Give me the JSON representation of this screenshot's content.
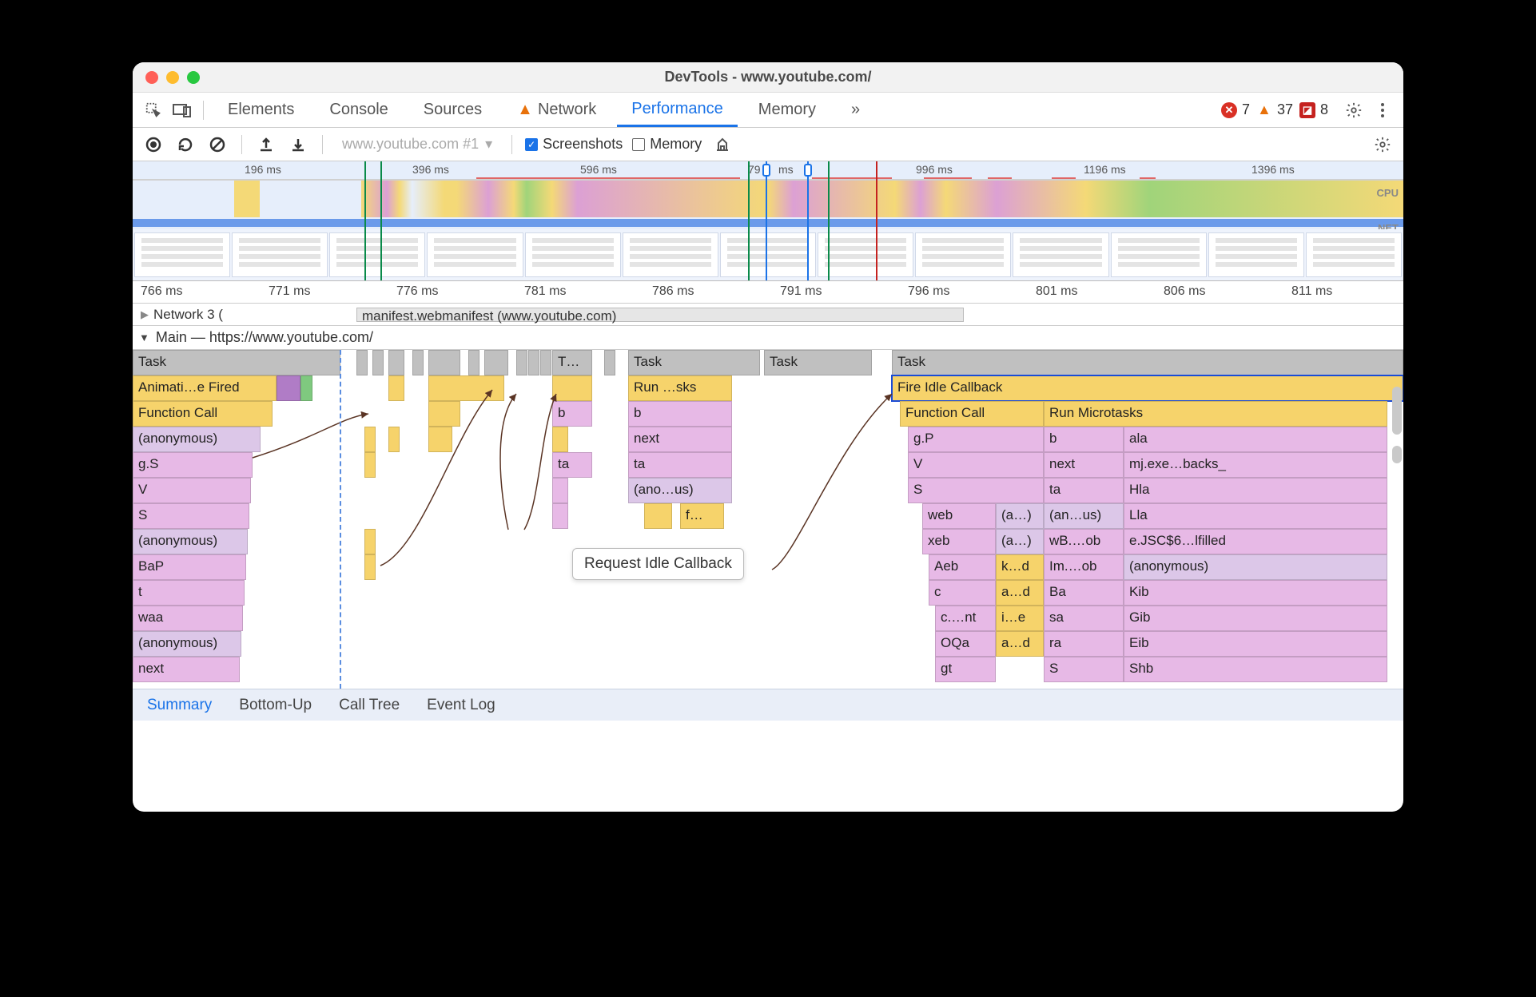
{
  "window": {
    "title": "DevTools - www.youtube.com/"
  },
  "tabs": {
    "items": [
      "Elements",
      "Console",
      "Sources",
      "Network",
      "Performance",
      "Memory"
    ],
    "network_has_warning": true,
    "more": "»",
    "errors": 7,
    "warnings": 37,
    "issues": 8
  },
  "toolbar": {
    "recording_url": "www.youtube.com #1",
    "screenshots_label": "Screenshots",
    "screenshots_checked": true,
    "memory_label": "Memory",
    "memory_checked": false
  },
  "overview": {
    "ticks": [
      "196 ms",
      "396 ms",
      "596 ms",
      "79",
      "ms",
      "996 ms",
      "1196 ms",
      "1396 ms"
    ],
    "cpu_label": "CPU",
    "net_label": "NET"
  },
  "ruler": {
    "ticks": [
      "766 ms",
      "771 ms",
      "776 ms",
      "781 ms",
      "786 ms",
      "791 ms",
      "796 ms",
      "801 ms",
      "806 ms",
      "811 ms"
    ]
  },
  "network_row": {
    "label": "Network",
    "count": "3 (",
    "item": "manifest.webmanifest (www.youtube.com)"
  },
  "main": {
    "label": "Main — https://www.youtube.com/"
  },
  "flame": {
    "r0": {
      "task": "Task",
      "t": "T…",
      "task2": "Task",
      "task3": "Task",
      "task4": "Task"
    },
    "r1": {
      "anim": "Animati…e Fired",
      "run": "Run …sks",
      "fire": "Fire Idle Callback"
    },
    "r2": {
      "fc": "Function Call",
      "b": "b",
      "b2": "b",
      "fc2": "Function Call",
      "runm": "Run Microtasks"
    },
    "r3": {
      "anon": "(anonymous)",
      "next": "next",
      "gp": "g.P",
      "b3": "b",
      "ala": "ala"
    },
    "r4": {
      "gs": "g.S",
      "ta": "ta",
      "ta2": "ta",
      "v2": "V",
      "next2": "next",
      "mj": "mj.exe…backs_"
    },
    "r5": {
      "v": "V",
      "anon2": "(ano…us)",
      "s2": "S",
      "ta3": "ta",
      "hla": "Hla"
    },
    "r6": {
      "s": "S",
      "f": "f…",
      "web": "web",
      "a1": "(a…)",
      "anon3": "(an…us)",
      "lla": "Lla"
    },
    "r7": {
      "anon4": "(anonymous)",
      "xeb": "xeb",
      "a2": "(a…)",
      "wb": "wB.…ob",
      "ejsc": "e.JSC$6…lfilled"
    },
    "r8": {
      "bap": "BaP",
      "aeb": "Aeb",
      "kd": "k…d",
      "im": "Im.…ob",
      "anon5": "(anonymous)"
    },
    "r9": {
      "t": "t",
      "c": "c",
      "ad": "a…d",
      "ba": "Ba",
      "kib": "Kib"
    },
    "r10": {
      "waa": "waa",
      "cnt": "c.…nt",
      "ie": "i…e",
      "sa": "sa",
      "gib": "Gib"
    },
    "r11": {
      "anon6": "(anonymous)",
      "oqa": "OQa",
      "ad2": "a…d",
      "ra": "ra",
      "eib": "Eib"
    },
    "r12": {
      "next3": "next",
      "gt": "gt",
      "s3": "S",
      "shb": "Shb"
    }
  },
  "tooltip": "Request Idle Callback",
  "bottom": {
    "items": [
      "Summary",
      "Bottom-Up",
      "Call Tree",
      "Event Log"
    ]
  }
}
